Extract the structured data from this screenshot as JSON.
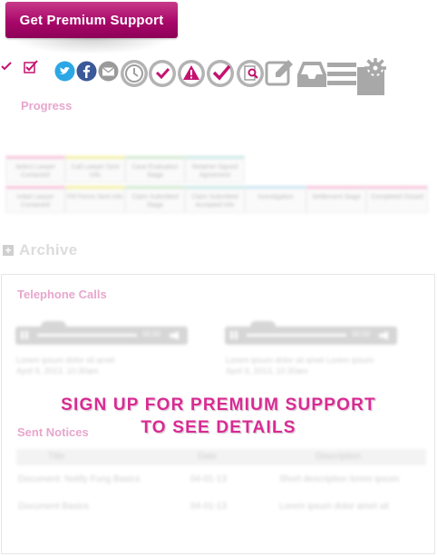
{
  "header": {
    "premium_button_label": "Get Premium Support"
  },
  "toolbar": {
    "icons": [
      "check-icon",
      "checkbox-icon",
      "twitter-icon",
      "facebook-icon",
      "email-icon",
      "clock-icon",
      "check-circle-icon",
      "alert-icon",
      "check-circle-filled-icon",
      "search-document-icon",
      "edit-icon",
      "inbox-icon",
      "menu-icon",
      "settings-icon"
    ]
  },
  "progress": {
    "title": "Progress",
    "stages_row1": [
      "Select Lawyer Contacted",
      "Call Lawyer Sent Info",
      "Case Evaluation Stage",
      "Retainer Signed Agreement"
    ],
    "stages_row2": [
      "Initial Lawyer Contacted",
      "Fill Forms Sent Info",
      "Claim Submitted Stage",
      "Claim Submitted Accepted Info",
      "Investigation",
      "Settlement Stage",
      "Completed Closed"
    ]
  },
  "archive": {
    "title": "Archive",
    "calls_title": "Telephone Calls",
    "calls": [
      {
        "time": "00:00",
        "text_line1": "Lorem ipsum dolor sit amet",
        "text_line2": "April 9, 2013, 10:30am"
      },
      {
        "time": "00:00",
        "text_line1": "Lorem ipsum dolor sit amet Lorem ipsum",
        "text_line2": "April 9, 2013, 10:30am"
      }
    ],
    "notices_title": "Sent Notices",
    "notices_columns": [
      "Title",
      "Date",
      "Description"
    ],
    "notices_rows": [
      [
        "Document: Notify Fung Basics",
        "04-01-13",
        "Short description lorem ipsum"
      ],
      [
        "Document Basics",
        "04-01-13",
        "Lorem ipsum dolor amet sit"
      ]
    ]
  },
  "overlay": {
    "line1": "SIGN UP FOR PREMIUM SUPPORT",
    "line2": "TO SEE DETAILS"
  },
  "colors": {
    "brand": "#a8086a",
    "overlay_text": "#d82a92",
    "section_title": "#e8a6cd",
    "twitter": "#2ba7e5",
    "facebook": "#3b5998",
    "icon_gray": "#9a9a9a"
  }
}
